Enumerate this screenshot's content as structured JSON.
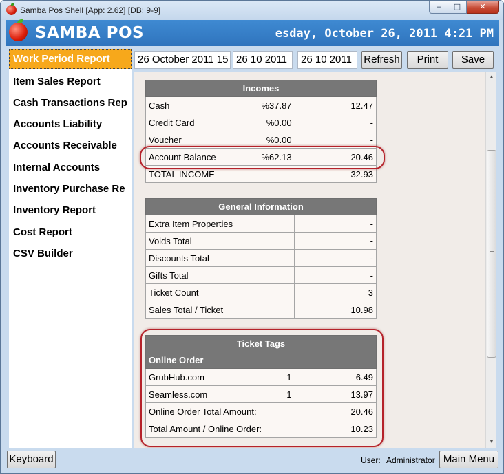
{
  "window": {
    "title": "Samba Pos Shell [App: 2.62] [DB: 9-9]",
    "minimize_icon": "minimize-icon",
    "maximize_icon": "maximize-icon",
    "close_icon": "close-icon"
  },
  "header": {
    "brand": "SAMBA POS",
    "clock": "esday, October 26, 2011 4:21 PM",
    "accent_color": "#3a83cc"
  },
  "sidebar": {
    "items": [
      {
        "label": "Work Period Report",
        "active": true
      },
      {
        "label": "Item Sales Report"
      },
      {
        "label": "Cash Transactions Rep"
      },
      {
        "label": "Accounts Liability"
      },
      {
        "label": "Accounts Receivable"
      },
      {
        "label": "Internal Accounts"
      },
      {
        "label": "Inventory Purchase Re"
      },
      {
        "label": "Inventory Report"
      },
      {
        "label": "Cost Report"
      },
      {
        "label": "CSV Builder"
      }
    ],
    "active_color": "#f7a81b"
  },
  "toolbar": {
    "period_select": "26 October 2011 15",
    "start_date": "26 10 2011",
    "end_date": "26 10 2011",
    "refresh_label": "Refresh",
    "print_label": "Print",
    "save_label": "Save"
  },
  "report": {
    "incomes": {
      "title": "Incomes",
      "rows": [
        {
          "name": "Cash",
          "percent": "%37.87",
          "amount": "12.47"
        },
        {
          "name": "Credit Card",
          "percent": "%0.00",
          "amount": "-"
        },
        {
          "name": "Voucher",
          "percent": "%0.00",
          "amount": "-"
        },
        {
          "name": "Account Balance",
          "percent": "%62.13",
          "amount": "20.46"
        }
      ],
      "total_label": "TOTAL INCOME",
      "total_amount": "32.93"
    },
    "general": {
      "title": "General Information",
      "rows": [
        {
          "name": "Extra Item Properties",
          "amount": "-"
        },
        {
          "name": "Voids Total",
          "amount": "-"
        },
        {
          "name": "Discounts Total",
          "amount": "-"
        },
        {
          "name": "Gifts Total",
          "amount": "-"
        },
        {
          "name": "Ticket Count",
          "amount": "3"
        },
        {
          "name": "Sales Total / Ticket",
          "amount": "10.98"
        }
      ]
    },
    "ticket_tags": {
      "title": "Ticket Tags",
      "group": "Online Order",
      "rows": [
        {
          "name": "GrubHub.com",
          "count": "1",
          "amount": "6.49"
        },
        {
          "name": "Seamless.com",
          "count": "1",
          "amount": "13.97"
        }
      ],
      "total_amount_label": "Online Order Total Amount:",
      "total_amount": "20.46",
      "avg_label": "Total Amount / Online Order:",
      "avg_amount": "10.23"
    },
    "highlight_color": "#b5222a"
  },
  "statusbar": {
    "keyboard_label": "Keyboard",
    "user_label": "User:",
    "user_name": "Administrator",
    "main_menu_label": "Main Menu"
  }
}
